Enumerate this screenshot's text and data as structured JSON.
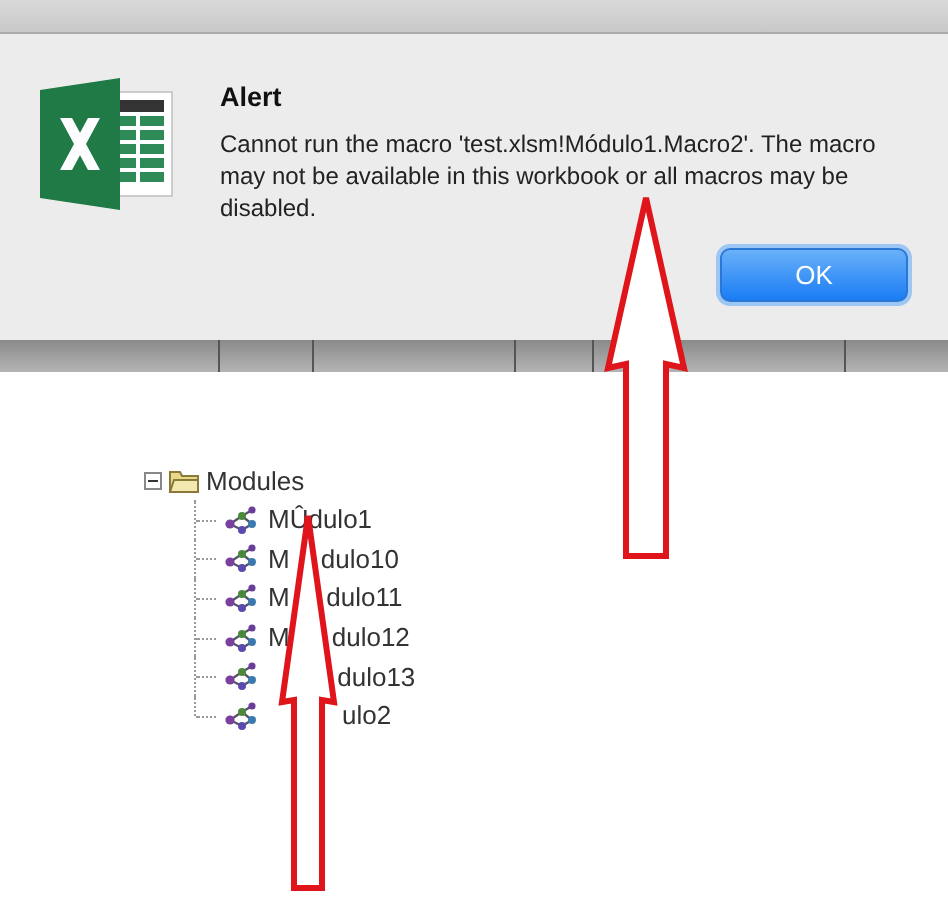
{
  "dialog": {
    "title": "Alert",
    "message": "Cannot run the macro 'test.xlsm!Módulo1.Macro2'. The macro may not be available in this workbook or all macros may be disabled.",
    "buttons": [
      {
        "label": "OK",
        "default": true
      }
    ]
  },
  "tree": {
    "label": "Modules",
    "expanded": true,
    "children": [
      {
        "label_parts": [
          "MÛdulo1"
        ]
      },
      {
        "label_parts": [
          "M",
          "dulo10"
        ]
      },
      {
        "label_parts": [
          "M",
          "dulo11"
        ]
      },
      {
        "label_parts": [
          "M",
          "dulo12"
        ]
      },
      {
        "label_parts": [
          "dulo13"
        ]
      },
      {
        "label_parts": [
          "ulo2"
        ]
      }
    ]
  }
}
